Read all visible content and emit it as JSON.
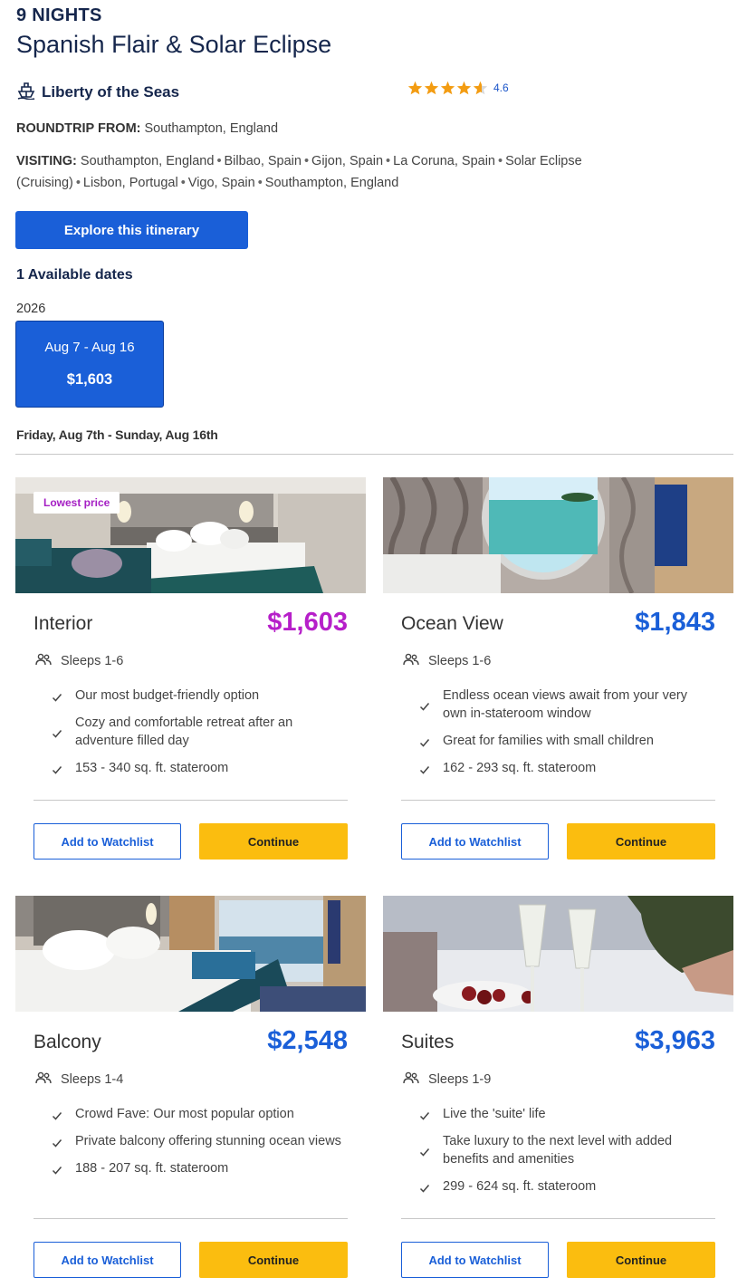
{
  "header": {
    "nights": "9 NIGHTS",
    "title": "Spanish Flair & Solar Eclipse",
    "ship_name": "Liberty of the Seas",
    "rating_value": "4.6",
    "rating_stars": 4.6
  },
  "roundtrip": {
    "label": "ROUNDTRIP FROM:",
    "value": "Southampton, England"
  },
  "visiting": {
    "label": "VISITING:",
    "ports": [
      "Southampton, England",
      "Bilbao, Spain",
      "Gijon, Spain",
      "La Coruna, Spain",
      "Solar Eclipse (Cruising)",
      "Lisbon, Portugal",
      "Vigo, Spain",
      "Southampton, England"
    ]
  },
  "explore_button": "Explore this itinerary",
  "available_dates": "1 Available dates",
  "year": "2026",
  "date_option": {
    "range": "Aug 7 - Aug 16",
    "price": "$1,603"
  },
  "selected_range": "Friday, Aug 7th - Sunday, Aug 16th",
  "colors": {
    "brand_blue": "#1a5fd8",
    "navy": "#15264c",
    "lowest_purple": "#b61fc9",
    "continue_yellow": "#fbbd0f"
  },
  "rooms": [
    {
      "name": "Interior",
      "price": "$1,603",
      "badge": "Lowest price",
      "sleeps": "Sleeps 1-6",
      "features": [
        "Our most budget-friendly option",
        "Cozy and comfortable retreat after an adventure filled day",
        "153 - 340 sq. ft. stateroom"
      ],
      "watch_label": "Add to Watchlist",
      "continue_label": "Continue"
    },
    {
      "name": "Ocean View",
      "price": "$1,843",
      "sleeps": "Sleeps 1-6",
      "features": [
        "Endless ocean views await from your very own in-stateroom window",
        "Great for families with small children",
        "162 - 293 sq. ft. stateroom"
      ],
      "watch_label": "Add to Watchlist",
      "continue_label": "Continue"
    },
    {
      "name": "Balcony",
      "price": "$2,548",
      "sleeps": "Sleeps 1-4",
      "features": [
        "Crowd Fave: Our most popular option",
        "Private balcony offering stunning ocean views",
        "188 - 207 sq. ft. stateroom"
      ],
      "watch_label": "Add to Watchlist",
      "continue_label": "Continue"
    },
    {
      "name": "Suites",
      "price": "$3,963",
      "sleeps": "Sleeps 1-9",
      "features": [
        "Live the 'suite' life",
        "Take luxury to the next level with added benefits and amenities",
        "299 - 624 sq. ft. stateroom"
      ],
      "watch_label": "Add to Watchlist",
      "continue_label": "Continue"
    }
  ]
}
